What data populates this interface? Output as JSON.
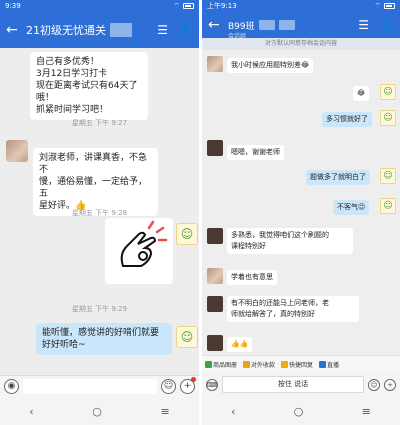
{
  "left": {
    "status": {
      "time": "9:39"
    },
    "header": {
      "title": "21初级无忧通关"
    },
    "messages": {
      "m1_line1": "自己有多优秀！",
      "m1_line2": "3月12日学习打卡",
      "m1_line3": "现在距离考试只有64天了哦！",
      "m1_line4": "抓紧时间学习吧！",
      "t1": "星期五 下午 9:27",
      "m2_line1": "刘淑老师，讲课真香，不急不",
      "m2_line2": "慢，通俗易懂，一定给予，五",
      "m2_line3": "星好评。👍",
      "t2": "星期五 下午 9:28",
      "t3": "星期五 下午 9:29",
      "m3_line1": "能听懂，感觉讲的好啃们就要",
      "m3_line2": "好好听哈~"
    },
    "nav": {
      "back": "‹",
      "home": "○",
      "menu": "≡"
    }
  },
  "right": {
    "status": {
      "time": "上午9:13"
    },
    "header": {
      "title": "B99班",
      "subtitle": "会话组"
    },
    "notice": "对方默认同意存档会话内容",
    "messages": {
      "r1": "我小时候应用题特别差😂",
      "r2": "😂",
      "r3": "多习惯就好了",
      "r4": "嗯嗯，谢谢老师",
      "r5": "题做多了就明白了",
      "r6": "不客气😉",
      "r7_line1": "多熟悉，我觉得咱们这个刷题的",
      "r7_line2": "课程特别好",
      "r8": "学着也有意思",
      "r9_line1": "有不明白的还能马上问老师，老",
      "r9_line2": "师就给解答了，真的特别好",
      "r10": "👍👍"
    },
    "toolbar": [
      "商品图册",
      "对外收款",
      "快捷回复",
      "直播"
    ],
    "input": {
      "hold": "按住 说话"
    },
    "nav": {
      "back": "‹",
      "home": "○",
      "menu": "≡"
    }
  }
}
